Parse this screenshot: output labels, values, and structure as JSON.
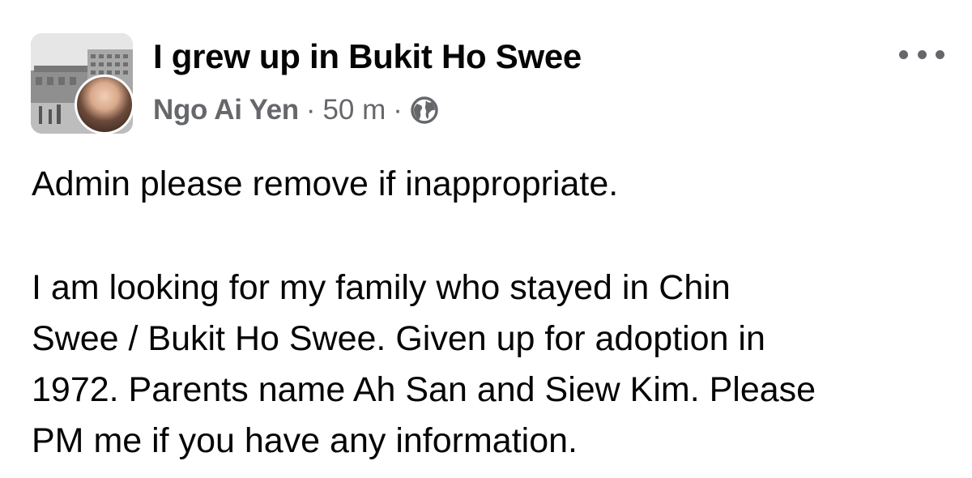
{
  "post": {
    "group_name": "I grew up in Bukit Ho Swee",
    "author": "Ngo Ai Yen",
    "separator": "·",
    "time": "50 m",
    "privacy_icon": "globe-icon",
    "more_icon": "more-options-icon",
    "body": {
      "paragraph_1": "Admin please remove if inappropriate.",
      "paragraph_2_lines": [
        "I am looking for my family who stayed in Chin",
        "Swee / Bukit Ho Swee. Given up for adoption in",
        "1972. Parents name Ah San and Siew Kim. Please",
        "PM me if you have any information."
      ]
    }
  },
  "colors": {
    "primary_text": "#050505",
    "secondary_text": "#65676b",
    "background": "#ffffff"
  }
}
